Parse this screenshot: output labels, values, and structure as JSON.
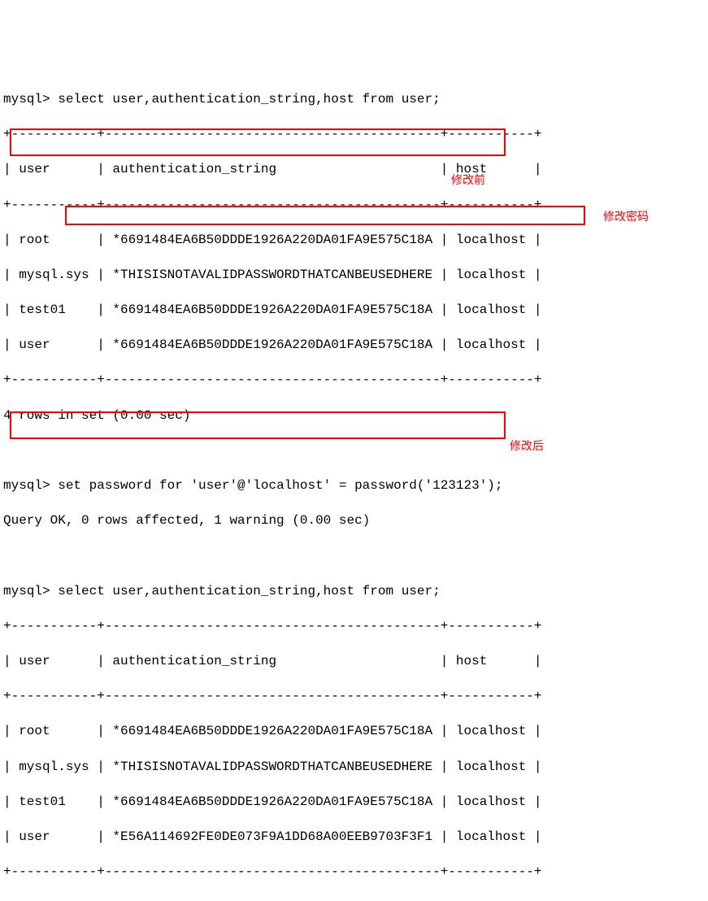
{
  "terminal": {
    "prompt": "mysql>",
    "query1": "select user,authentication_string,host from user;",
    "table1": {
      "sep_top": "+-----------+-------------------------------------------+-----------+",
      "header_row": "| user      | authentication_string                     | host      |",
      "sep_mid": "+-----------+-------------------------------------------+-----------+",
      "rows": [
        "| root      | *6691484EA6B50DDDE1926A220DA01FA9E575C18A | localhost |",
        "| mysql.sys | *THISISNOTAVALIDPASSWORDTHATCANBEUSEDHERE | localhost |",
        "| test01    | *6691484EA6B50DDDE1926A220DA01FA9E575C18A | localhost |",
        "| user      | *6691484EA6B50DDDE1926A220DA01FA9E575C18A | localhost |"
      ],
      "sep_bot": "+-----------+-------------------------------------------+-----------+",
      "result": "4 rows in set (0.00 sec)"
    },
    "query2": "set password for 'user'@'localhost' = password('123123');",
    "query2_result": "Query OK, 0 rows affected, 1 warning (0.00 sec)",
    "query3": "select user,authentication_string,host from user;",
    "table2": {
      "sep_top": "+-----------+-------------------------------------------+-----------+",
      "header_row": "| user      | authentication_string                     | host      |",
      "sep_mid": "+-----------+-------------------------------------------+-----------+",
      "rows": [
        "| root      | *6691484EA6B50DDDE1926A220DA01FA9E575C18A | localhost |",
        "| mysql.sys | *THISISNOTAVALIDPASSWORDTHATCANBEUSEDHERE | localhost |",
        "| test01    | *6691484EA6B50DDDE1926A220DA01FA9E575C18A | localhost |",
        "| user      | *E56A114692FE0DE073F9A1DD68A00EEB9703F3F1 | localhost |"
      ],
      "sep_bot": "+-----------+-------------------------------------------+-----------+"
    }
  },
  "annotations": {
    "before": "修改前",
    "change_pwd": "修改密码",
    "after": "修改后"
  }
}
